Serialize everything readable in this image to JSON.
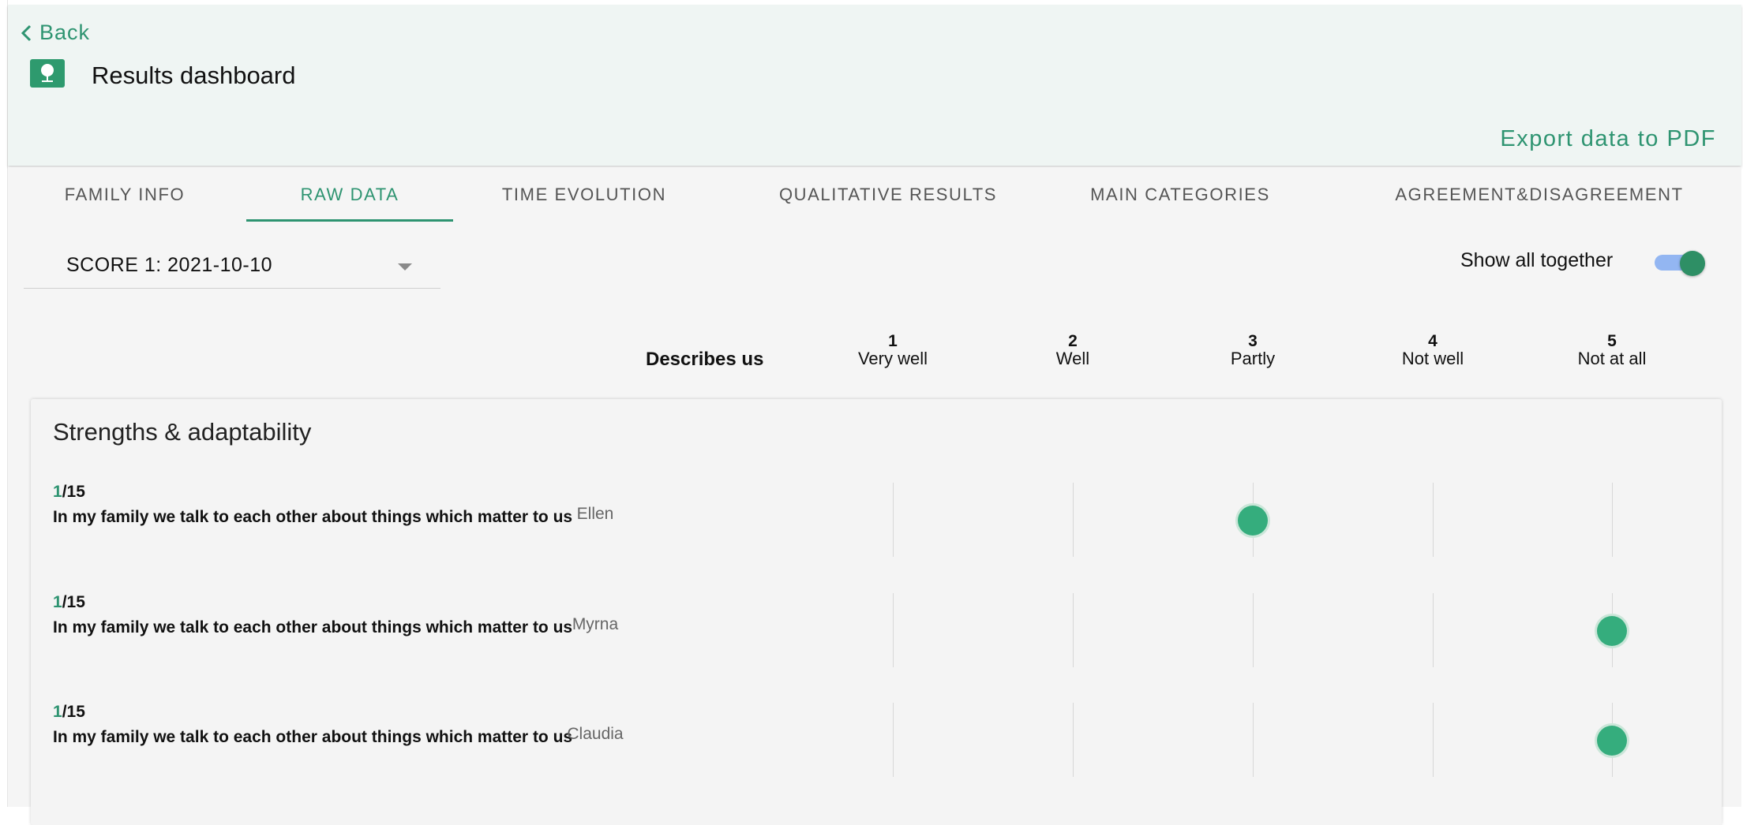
{
  "header": {
    "back_label": "Back",
    "title": "Results dashboard",
    "export_label": "Export data to PDF",
    "icons": {
      "back": "chevron-left-icon",
      "logo": "tree-icon"
    }
  },
  "tabs": [
    {
      "label": "FAMILY INFO",
      "active": false
    },
    {
      "label": "RAW DATA",
      "active": true
    },
    {
      "label": "TIME EVOLUTION",
      "active": false
    },
    {
      "label": "QUALITATIVE RESULTS",
      "active": false
    },
    {
      "label": "MAIN CATEGORIES",
      "active": false
    },
    {
      "label": "AGREEMENT&DISAGREEMENT",
      "active": false
    }
  ],
  "score_select": {
    "value": "SCORE 1: 2021-10-10"
  },
  "show_all": {
    "label": "Show all together",
    "on": true
  },
  "scale": {
    "heading": "Describes us",
    "levels": [
      {
        "num": "1",
        "label": "Very well"
      },
      {
        "num": "2",
        "label": "Well"
      },
      {
        "num": "3",
        "label": "Partly"
      },
      {
        "num": "4",
        "label": "Not well"
      },
      {
        "num": "5",
        "label": "Not at all"
      }
    ]
  },
  "section": {
    "title": "Strengths & adaptability",
    "rows": [
      {
        "current": "1",
        "total": "/15",
        "question": "In my family we talk to each other about things which matter to us",
        "member": "Ellen",
        "score": 3
      },
      {
        "current": "1",
        "total": "/15",
        "question": "In my family we talk to each other about things which matter to us",
        "member": "Myrna",
        "score": 5
      },
      {
        "current": "1",
        "total": "/15",
        "question": "In my family we talk to each other about things which matter to us",
        "member": "Claudia",
        "score": 5
      }
    ]
  },
  "colors": {
    "accent": "#2e9471",
    "dot": "#35ad7d",
    "header_bg": "#eff5f3",
    "content_bg": "#f5f5f5",
    "toggle_track": "#93b6f2"
  }
}
